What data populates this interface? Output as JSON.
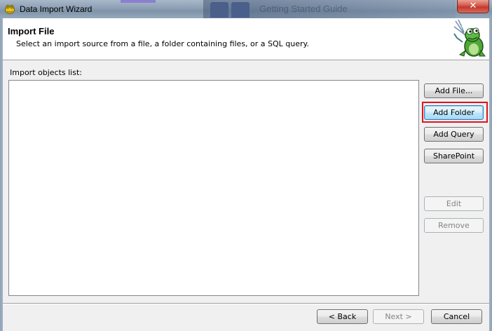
{
  "window": {
    "title": "Data Import Wizard",
    "close_label": "✕",
    "background_ghost_text": "Getting Started Guide"
  },
  "header": {
    "title": "Import File",
    "subtitle": "Select an import source from a file, a folder containing files, or a SQL query."
  },
  "list": {
    "label": "Import objects list:",
    "items": []
  },
  "side_buttons": {
    "add_file": "Add File...",
    "add_folder": "Add Folder",
    "add_query": "Add Query",
    "sharepoint": "SharePoint",
    "edit": "Edit",
    "remove": "Remove"
  },
  "footer": {
    "back": "< Back",
    "next": "Next >",
    "cancel": "Cancel"
  },
  "colors": {
    "highlight": "#e0141e",
    "title_bar": "#8fa2b7",
    "close_button": "#c4392b"
  },
  "icons": {
    "app": "toad-icon",
    "logo": "toad-mascot-icon"
  }
}
